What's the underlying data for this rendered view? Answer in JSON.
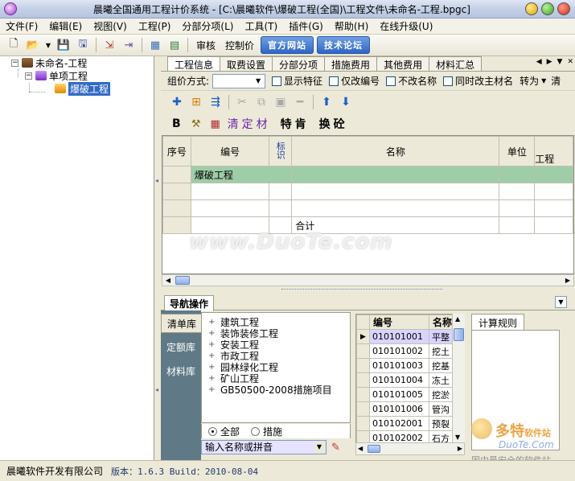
{
  "window": {
    "title": "晨曦全国通用工程计价系统 - [C:\\晨曦软件\\爆破工程(全国)\\工程文件\\未命名-工程.bpgc]"
  },
  "menu": [
    "文件(F)",
    "编辑(E)",
    "视图(V)",
    "工程(P)",
    "分部分项(L)",
    "工具(T)",
    "插件(G)",
    "帮助(H)",
    "在线升级(U)"
  ],
  "toolbar": {
    "review_label": "审核",
    "price_control_label": "控制价",
    "official_site_label": "官方网站",
    "forum_label": "技术论坛"
  },
  "tree": {
    "root": "未命名-工程",
    "unit": "单项工程",
    "item": "爆破工程"
  },
  "tabs": [
    "工程信息",
    "取费设置",
    "分部分项",
    "措施费用",
    "其他费用",
    "材料汇总"
  ],
  "options": {
    "price_mode_label": "组价方式:",
    "price_mode_value": "",
    "show_features": "显示特征",
    "only_code": "仅改编号",
    "no_name_change": "不改名称",
    "sync_material": "同时改主材名",
    "convert": "转为",
    "clear": "清"
  },
  "format_bar": {
    "bold": "B",
    "qing_ding_cai": "清定材",
    "te_xiao": "特肯",
    "huan_suan": "换砼"
  },
  "grid": {
    "headers": [
      "序号",
      "编号",
      "标识",
      "名称",
      "单位",
      "工程"
    ],
    "rows": [
      {
        "seq": "",
        "code": "",
        "mark": "",
        "name": "爆破工程",
        "unit": "",
        "qty": "",
        "highlight": true
      },
      {
        "seq": "",
        "code": "",
        "mark": "",
        "name": "",
        "unit": "",
        "qty": ""
      },
      {
        "seq": "",
        "code": "",
        "mark": "",
        "name": "",
        "unit": "",
        "qty": ""
      },
      {
        "seq": "",
        "code": "",
        "mark": "",
        "name": "合计",
        "unit": "",
        "qty": ""
      }
    ]
  },
  "nav": {
    "tab": "导航操作",
    "side": [
      "清单库",
      "定额库",
      "材料库"
    ],
    "library": [
      "建筑工程",
      "装饰装修工程",
      "安装工程",
      "市政工程",
      "园林绿化工程",
      "矿山工程",
      "GB50500-2008措施项目"
    ],
    "radio_all": "全部",
    "radio_measure": "措施",
    "search_placeholder": "输入名称或拼音",
    "code_headers": [
      "编号",
      "名称"
    ],
    "codes": [
      {
        "code": "010101001",
        "name": "平整"
      },
      {
        "code": "010101002",
        "name": "挖土"
      },
      {
        "code": "010101003",
        "name": "挖基"
      },
      {
        "code": "010101004",
        "name": "冻土"
      },
      {
        "code": "010101005",
        "name": "挖淤"
      },
      {
        "code": "010101006",
        "name": "管沟"
      },
      {
        "code": "010102001",
        "name": "预裂"
      },
      {
        "code": "010102002",
        "name": "石方"
      }
    ],
    "calc_rules_label": "计算规则"
  },
  "status": {
    "company": "晨曦软件开发有限公司",
    "version": "版本：1.6.3 Build：2010-08-04"
  },
  "watermark": {
    "site": "www.DuoTe.com",
    "logo_cn": "多特",
    "logo_small": "软件站",
    "logo_en": "DuoTe.Com",
    "logo_slogan": "国内最安全的软件站"
  }
}
